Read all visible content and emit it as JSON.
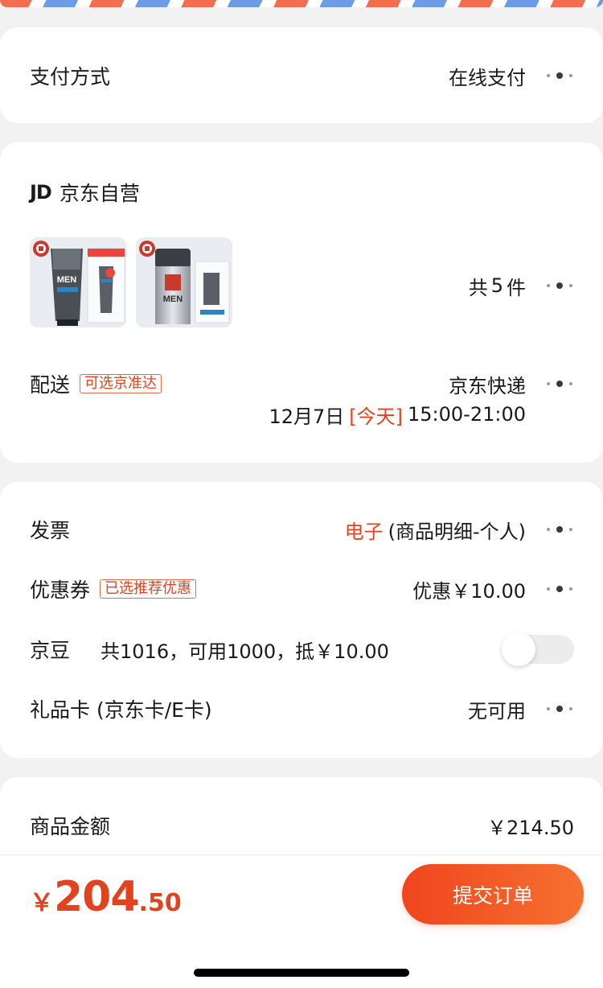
{
  "payment": {
    "label": "支付方式",
    "value": "在线支付"
  },
  "store": {
    "logo_text": "JD",
    "name": "京东自营",
    "products": [
      {
        "brand_text": "MEN",
        "image": "cleanser-tube-with-box"
      },
      {
        "brand_text": "MEN",
        "image": "lotion-bottle-with-box"
      }
    ],
    "count_prefix": "共",
    "count": "5",
    "count_suffix": "件",
    "delivery_label": "配送",
    "delivery_tag": "可选京准达",
    "delivery_method": "京东快递",
    "delivery_date": "12月7日",
    "delivery_today": "[今天]",
    "delivery_time": "15:00-21:00"
  },
  "options": {
    "invoice_label": "发票",
    "invoice_type": "电子",
    "invoice_detail": "(商品明细-个人)",
    "coupon_label": "优惠券",
    "coupon_tag": "已选推荐优惠",
    "coupon_value": "优惠￥10.00",
    "beans_label": "京豆",
    "beans_text": "共1016，可用1000，抵￥10.00",
    "beans_enabled": false,
    "giftcard_label": "礼品卡 (京东卡/E卡)",
    "giftcard_value": "无可用"
  },
  "summary": {
    "label": "商品金额",
    "value": "￥214.50"
  },
  "footer": {
    "currency": "￥",
    "total_int": "204",
    "total_dec": ".50",
    "submit_label": "提交订单"
  },
  "colors": {
    "accent": "#e2431f",
    "button_start": "#f0451f",
    "button_end": "#f5712f"
  }
}
